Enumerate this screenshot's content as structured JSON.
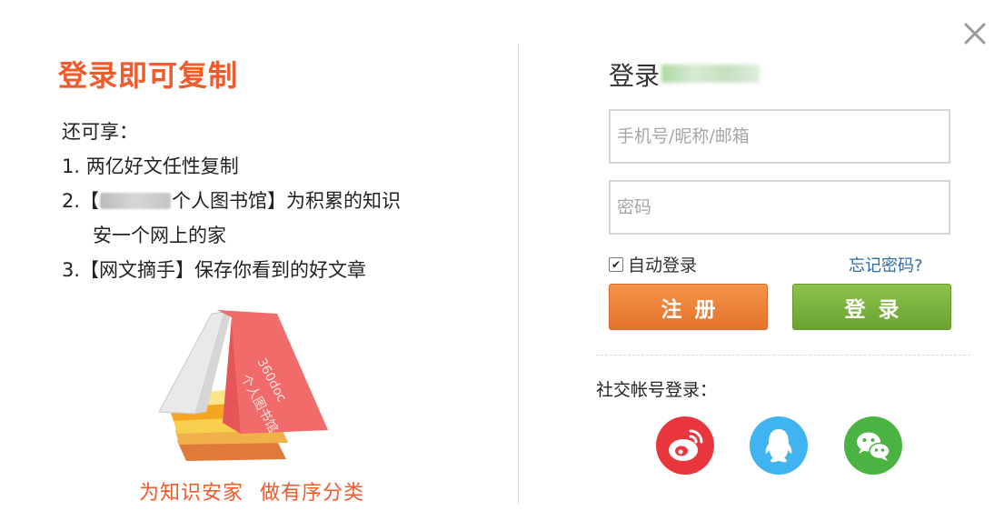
{
  "promo": {
    "title": "登录即可复制",
    "intro": "还可享：",
    "perk1": "1. 两亿好文任性复制",
    "perk2_prefix": "2.【",
    "perk2_suffix": "个人图书馆】为积累的知识",
    "perk2_line2": "安一个网上的家",
    "perk3": "3.【网文摘手】保存你看到的好文章",
    "book_label_1": "360doc",
    "book_label_2": "个人图书馆",
    "slogan_1": "为知识安家",
    "slogan_2": "做有序分类"
  },
  "login": {
    "title": "登录",
    "username_placeholder": "手机号/昵称/邮箱",
    "password_placeholder": "密码",
    "auto_login_label": "自动登录",
    "auto_login_checked": true,
    "forgot_label": "忘记密码?",
    "register_label": "注册",
    "login_label": "登录",
    "social_label": "社交帐号登录：",
    "social": [
      "weibo-icon",
      "qq-icon",
      "wechat-icon"
    ]
  },
  "colors": {
    "accent_orange": "#f15a2b",
    "register_btn": "#e98234",
    "login_btn": "#7cb23f",
    "link_blue": "#2c6aa8",
    "weibo": "#e8363c",
    "qq": "#3fb4f1",
    "wechat": "#4bb342"
  }
}
